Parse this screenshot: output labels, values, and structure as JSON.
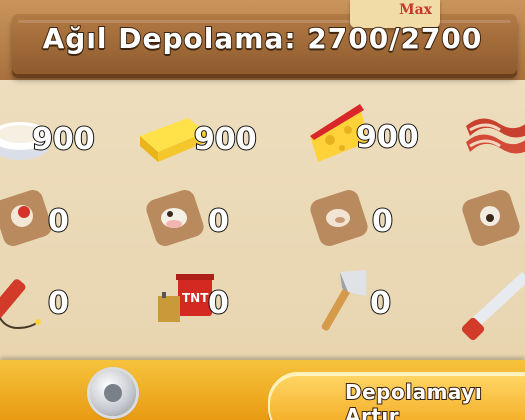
{
  "header": {
    "title": "Ağıl Depolama: 2700/2700",
    "max_label": "Max"
  },
  "items": [
    {
      "name": "cream",
      "count": "900"
    },
    {
      "name": "butter",
      "count": "900"
    },
    {
      "name": "cheese",
      "count": "900"
    },
    {
      "name": "bacon",
      "count": ""
    },
    {
      "name": "chicken-sack",
      "count": "0"
    },
    {
      "name": "cow-sack",
      "count": "0"
    },
    {
      "name": "pig-sack",
      "count": "0"
    },
    {
      "name": "sheep-sack",
      "count": ""
    },
    {
      "name": "dynamite",
      "count": "0"
    },
    {
      "name": "tnt-bucket",
      "count": "0"
    },
    {
      "name": "axe",
      "count": "0"
    },
    {
      "name": "saw",
      "count": ""
    }
  ],
  "footer": {
    "expand_button_label": "Depolamayı Artır"
  },
  "colors": {
    "bottom_bar": "#f1a418",
    "wood": "#8f5b2d"
  }
}
